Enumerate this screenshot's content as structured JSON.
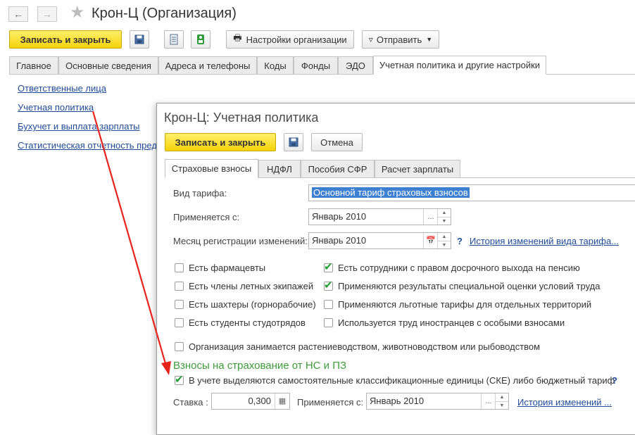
{
  "window": {
    "title": "Крон-Ц (Организация)"
  },
  "toolbar": {
    "save_close": "Записать и закрыть",
    "org_settings": "Настройки организации",
    "send": "Отправить"
  },
  "tabs": [
    "Главное",
    "Основные сведения",
    "Адреса и телефоны",
    "Коды",
    "Фонды",
    "ЭДО",
    "Учетная политика и другие настройки"
  ],
  "side_links": [
    "Ответственные лица",
    "Учетная политика",
    "Бухучет и выплата зарплаты",
    "Статистическая отчетность предп"
  ],
  "dialog": {
    "title": "Крон-Ц: Учетная политика",
    "save_close": "Записать и закрыть",
    "cancel": "Отмена",
    "tabs": [
      "Страховые взносы",
      "НДФЛ",
      "Пособия СФР",
      "Расчет зарплаты"
    ],
    "fields": {
      "tariff_label": "Вид тарифа:",
      "tariff_value": "Основной тариф страховых взносов",
      "applies_label": "Применяется с:",
      "applies_value": "Январь 2010",
      "reg_month_label": "Месяц регистрации изменений:",
      "reg_month_value": "Январь 2010",
      "help": "?",
      "tariff_history_link": "История изменений вида тарифа..."
    },
    "checkboxes_left": [
      {
        "label": "Есть фармацевты",
        "checked": false
      },
      {
        "label": "Есть члены летных экипажей",
        "checked": false
      },
      {
        "label": "Есть шахтеры (горнорабочие)",
        "checked": false
      },
      {
        "label": "Есть студенты студотрядов",
        "checked": false
      }
    ],
    "checkboxes_right": [
      {
        "label": "Есть сотрудники с правом досрочного выхода на пенсию",
        "checked": true
      },
      {
        "label": "Применяются результаты специальной оценки условий труда",
        "checked": true
      },
      {
        "label": "Применяются льготные тарифы для отдельных территорий",
        "checked": false
      },
      {
        "label": "Используется труд иностранцев с особыми взносами",
        "checked": false
      }
    ],
    "agri_checkbox": {
      "label": "Организация занимается растениеводством, животноводством или рыбоводством",
      "checked": false
    },
    "section_title": "Взносы на страхование от НС и ПЗ",
    "ske_checkbox": {
      "label": "В учете выделяются самостоятельные классификационные единицы (СКЕ) либо бюджетный тариф",
      "checked": true
    },
    "rate_label": "Ставка :",
    "rate_value": "0,300",
    "rate_applies_label": "Применяется с:",
    "rate_applies_value": "Январь 2010",
    "rate_history_link": "История изменений ..."
  },
  "annotation": {
    "arrow_color": "#e8231b"
  }
}
